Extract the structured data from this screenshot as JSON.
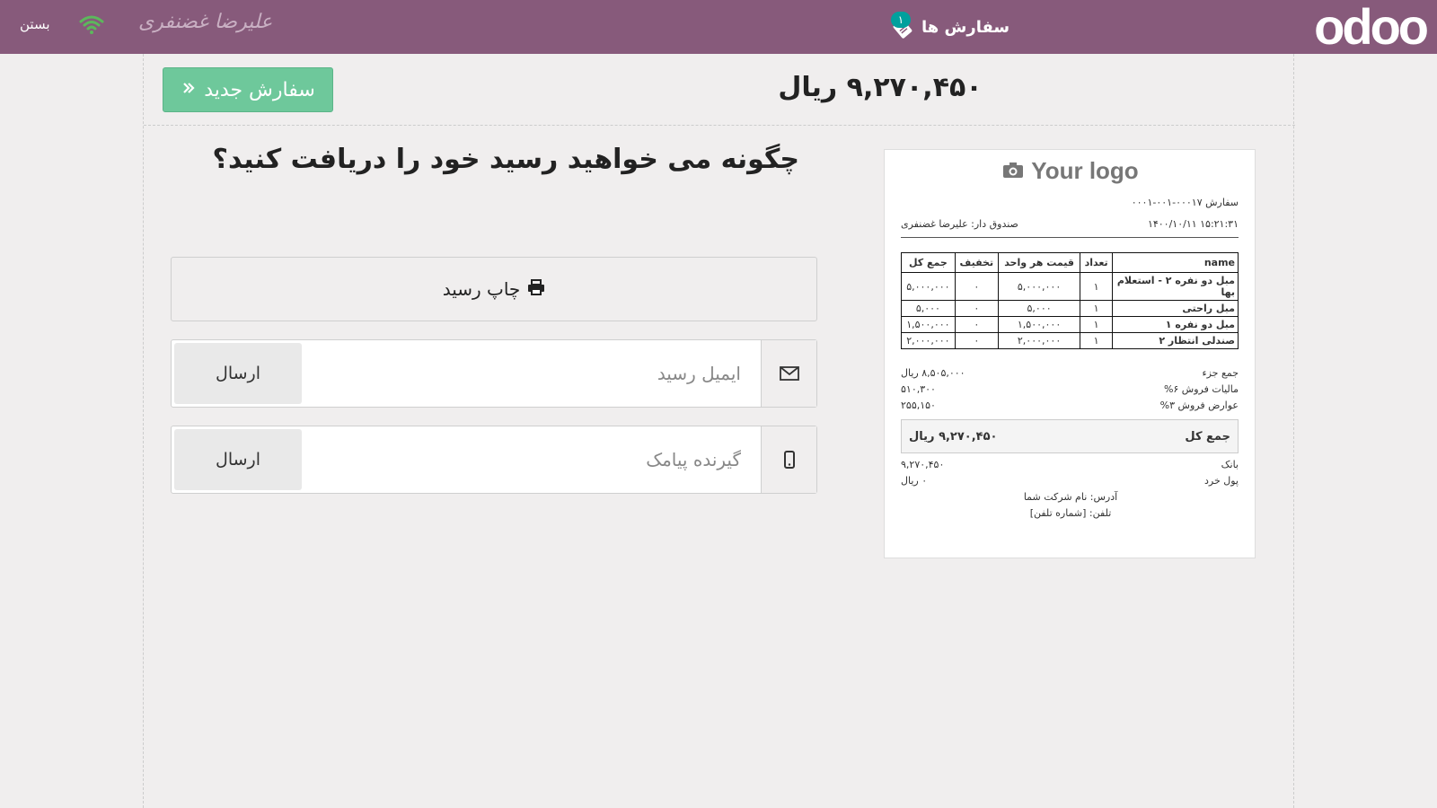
{
  "topbar": {
    "logo_text": "odoo",
    "orders_label": "سفارش ها",
    "orders_badge": "۱",
    "cashier_name": "علیرضا غضنفری",
    "close_label": "بستن",
    "bg_color": "#875a7b",
    "wifi_color": "#5cb85c"
  },
  "header": {
    "new_order_label": "سفارش جدید",
    "total": "۹,۲۷۰,۴۵۰ ریال"
  },
  "main": {
    "question": "چگونه می خواهید رسید خود را دریافت کنید؟",
    "print_label": "چاپ رسید",
    "email_placeholder": "ایمیل رسید",
    "sms_placeholder": "گیرنده پیامک",
    "send_label": "ارسال"
  },
  "receipt": {
    "logo_text": "Your logo",
    "order_ref": "سفارش ۰۰۰۱۷-۰۰۱-۰۰۰۱",
    "date": "۱۴۰۰/۱۰/۱۱ ۱۵:۲۱:۳۱",
    "cashier": "صندوق دار: علیرضا غضنفری",
    "columns": [
      "name",
      "تعداد",
      "قیمت هر واحد",
      "تخفیف",
      "جمع کل"
    ],
    "rows": [
      {
        "name": "مبل دو نفره ۲ - استعلام بها",
        "qty": "۱",
        "unit": "۵,۰۰۰,۰۰۰",
        "disc": "۰",
        "total": "۵,۰۰۰,۰۰۰"
      },
      {
        "name": "مبل راحتی",
        "qty": "۱",
        "unit": "۵,۰۰۰",
        "disc": "۰",
        "total": "۵,۰۰۰"
      },
      {
        "name": "مبل دو نفره ۱",
        "qty": "۱",
        "unit": "۱,۵۰۰,۰۰۰",
        "disc": "۰",
        "total": "۱,۵۰۰,۰۰۰"
      },
      {
        "name": "صندلی انتظار ۲",
        "qty": "۱",
        "unit": "۲,۰۰۰,۰۰۰",
        "disc": "۰",
        "total": "۲,۰۰۰,۰۰۰"
      }
    ],
    "subtotal_label": "جمع جزء",
    "subtotal_value": "۸,۵۰۵,۰۰۰ ریال",
    "tax1_label": "مالیات فروش ۶%",
    "tax1_value": "۵۱۰,۳۰۰",
    "tax2_label": "عوارض فروش ۳%",
    "tax2_value": "۲۵۵,۱۵۰",
    "grand_label": "جمع کل",
    "grand_value": "۹,۲۷۰,۴۵۰ ریال",
    "bank_label": "بانک",
    "bank_value": "۹,۲۷۰,۴۵۰",
    "change_label": "پول خرد",
    "change_value": "۰ ریال",
    "address": "آدرس: نام شرکت شما",
    "phone": "تلفن: [شماره تلفن]"
  }
}
